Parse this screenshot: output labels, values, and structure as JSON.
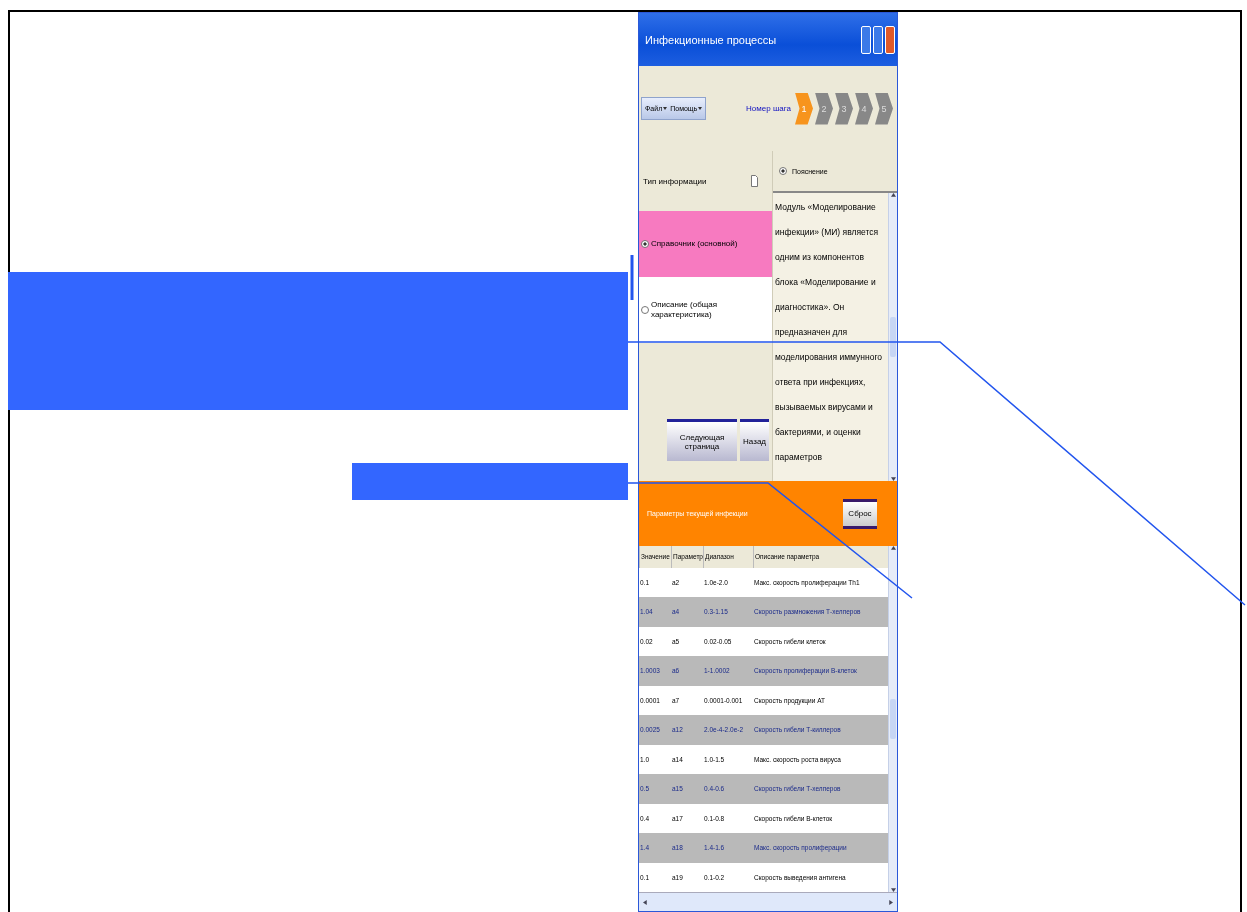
{
  "window": {
    "title": "Инфекционные процессы"
  },
  "menu": [
    {
      "label": "Файл"
    },
    {
      "label": "Помощь"
    }
  ],
  "steps": {
    "label": "Номер шага",
    "items": [
      {
        "label": "1",
        "selected": true
      },
      {
        "label": "2",
        "selected": false
      },
      {
        "label": "3",
        "selected": false
      },
      {
        "label": "4",
        "selected": false
      },
      {
        "label": "5",
        "selected": false
      }
    ]
  },
  "info_type": {
    "title": "Тип информации",
    "options": [
      {
        "label": "Справочник (основной)",
        "selected": true
      },
      {
        "label": "Описание (общая характеристика)",
        "selected": false
      }
    ]
  },
  "buttons": [
    "Следующая страница",
    "Назад"
  ],
  "explanation": {
    "label": "Пояснение",
    "selected": true,
    "text": "Модуль «Моделирование инфекции» (МИ) является одним из компонентов блока «Моделирование и диагностика». Он предназначен для моделирования иммунного ответа при инфекциях, вызываемых вирусами и бактериями, и оценки параметров"
  },
  "parameters": {
    "title": "Параметры текущей инфекции",
    "reset_button": "Сброс",
    "columns": [
      "Значение",
      "Параметр",
      "Диапазон",
      "Описание параметра"
    ],
    "rows": [
      [
        "0.1",
        "a2",
        "1.0e-2.0",
        "Макс. скорость пролиферации Th1"
      ],
      [
        "1.04",
        "a4",
        "0.3-1.15",
        "Скорость размножения Т-хелперов"
      ],
      [
        "0.02",
        "a5",
        "0.02-0.05",
        "Скорость гибели клеток"
      ],
      [
        "1.0003",
        "a6",
        "1-1.0002",
        "Скорость пролиферации В-клеток"
      ],
      [
        "0.0001",
        "a7",
        "0.0001-0.001",
        "Скорость продукции АТ"
      ],
      [
        "0.0025",
        "a12",
        "2.0e-4-2.0e-2",
        "Скорость гибели Т-киллеров"
      ],
      [
        "1.0",
        "a14",
        "1.0-1.5",
        "Макс. скорость роста вируса"
      ],
      [
        "0.5",
        "a15",
        "0.4-0.6",
        "Скорость гибели Т-хелперов"
      ],
      [
        "0.4",
        "a17",
        "0.1-0.8",
        "Скорость гибели В-клеток"
      ],
      [
        "1.4",
        "a18",
        "1.4-1.6",
        "Макс. скорость пролиферации"
      ],
      [
        "0.1",
        "a19",
        "0.1-0.2",
        "Скорость выведения антигена"
      ]
    ]
  },
  "callouts": [
    {
      "kind": "box"
    },
    {
      "kind": "box"
    }
  ]
}
